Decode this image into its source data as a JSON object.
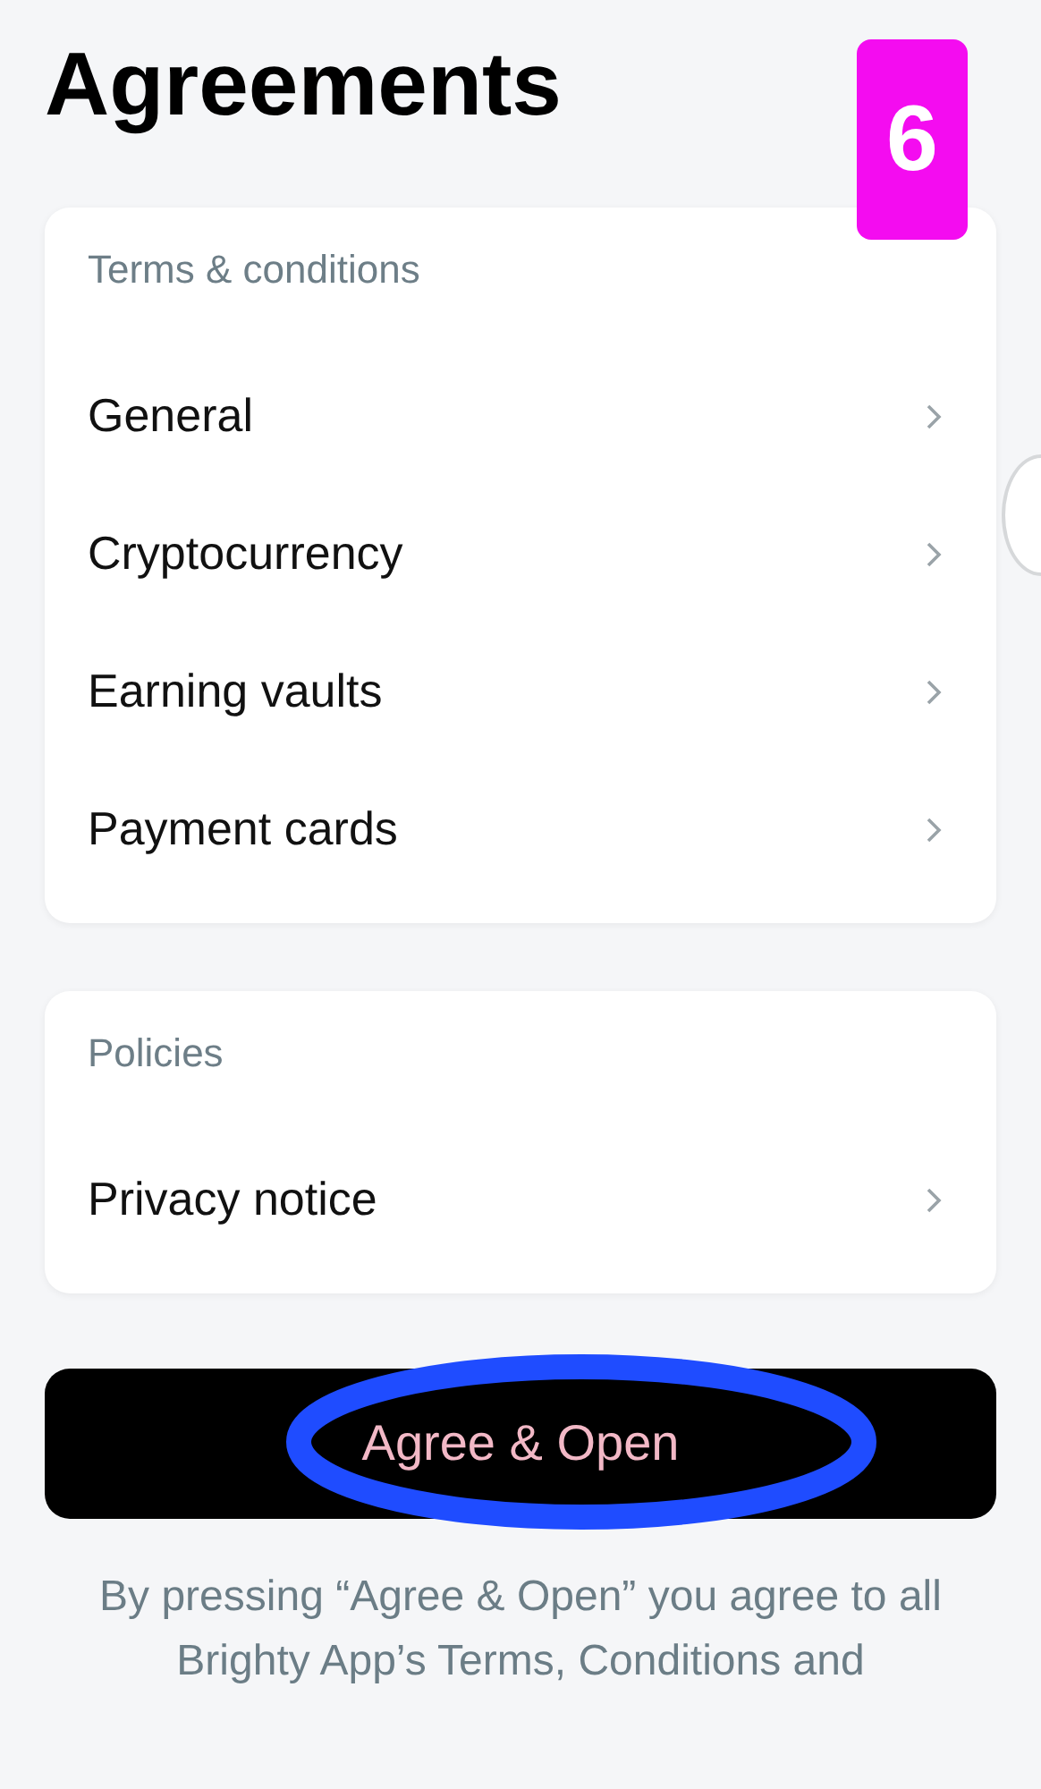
{
  "title": "Agreements",
  "step_badge": "6",
  "sections": [
    {
      "heading": "Terms & conditions",
      "items": [
        {
          "label": "General"
        },
        {
          "label": "Cryptocurrency"
        },
        {
          "label": "Earning vaults"
        },
        {
          "label": "Payment cards"
        }
      ]
    },
    {
      "heading": "Policies",
      "items": [
        {
          "label": "Privacy notice"
        }
      ]
    }
  ],
  "primary_button": {
    "label": "Agree & Open",
    "circled": true
  },
  "footnote": "By pressing “Agree & Open” you agree to all Brighty App’s Terms, Conditions and"
}
